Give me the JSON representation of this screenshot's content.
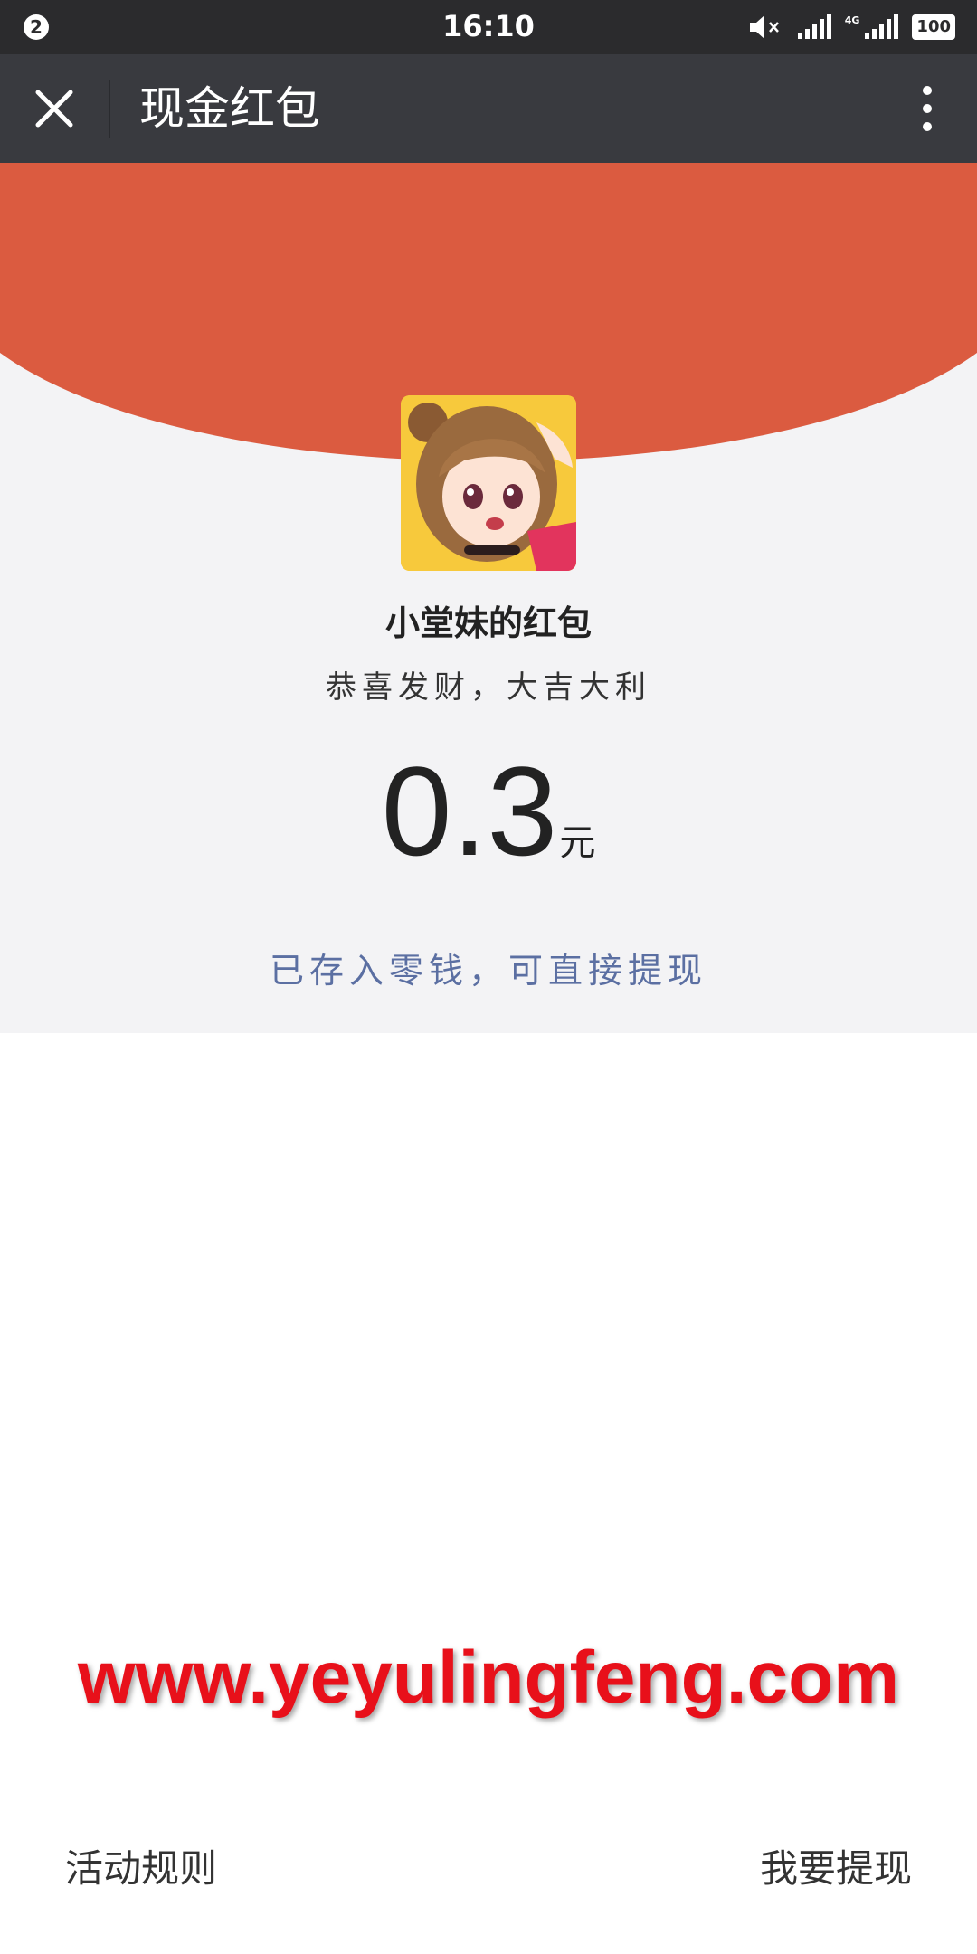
{
  "status_bar": {
    "notification_count": "2",
    "time": "16:10",
    "network_label": "4G",
    "battery": "100"
  },
  "nav": {
    "title": "现金红包"
  },
  "envelope": {
    "sender": "小堂妹的红包",
    "wish": "恭喜发财，大吉大利",
    "amount": "0.3",
    "unit": "元",
    "deposit_note": "已存入零钱，可直接提现"
  },
  "watermark": "www.yeyulingfeng.com",
  "footer": {
    "rules_label": "活动规则",
    "withdraw_label": "我要提现"
  },
  "colors": {
    "red": "#db5b40",
    "nav_bg": "#393a3f",
    "status_bg": "#2b2b2d",
    "link_blue": "#5b6fa2"
  }
}
